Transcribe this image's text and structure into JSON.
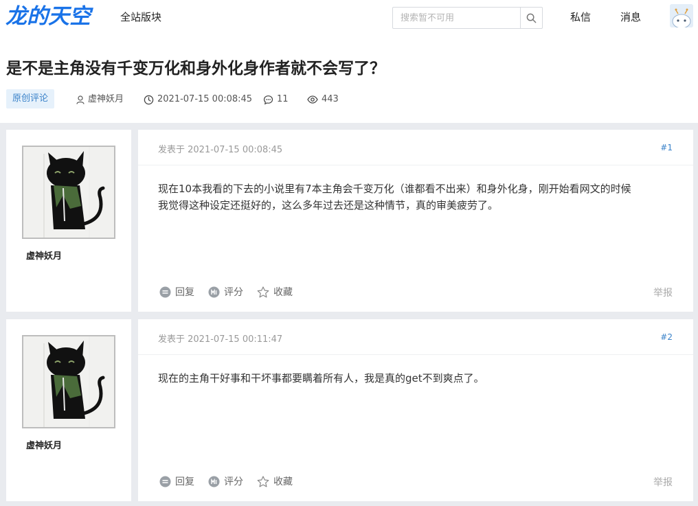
{
  "site": {
    "logo": "龙的天空",
    "nav_all_boards": "全站版块",
    "search_placeholder": "搜索暂不可用",
    "nav_messages": "私信",
    "nav_notifications": "消息",
    "brand_color": "#1a73e8"
  },
  "thread": {
    "title": "是不是主角没有千变万化和身外化身作者就不会写了？",
    "tag": "原创评论",
    "author": "虚神妖月",
    "datetime": "2021-07-15 00:08:45",
    "replies": "11",
    "views": "443"
  },
  "posts": [
    {
      "author": "虚神妖月",
      "date": "发表于 2021-07-15 00:08:45",
      "floor": "#1",
      "content_lines": [
        "现在10本我看的下去的小说里有7本主角会千变万化（谁都看不出来）和身外化身，刚开始看网文的时候",
        "我觉得这种设定还挺好的，这么多年过去还是这种情节，真的审美疲劳了。"
      ],
      "reply_label": "回复",
      "rate_label": "评分",
      "fav_label": "收藏",
      "report_label": "举报"
    },
    {
      "author": "虚神妖月",
      "date": "发表于 2021-07-15 00:11:47",
      "floor": "#2",
      "content_lines": [
        "现在的主角干好事和干坏事都要瞒着所有人，我是真的get不到爽点了。"
      ],
      "reply_label": "回复",
      "rate_label": "评分",
      "fav_label": "收藏",
      "report_label": "举报"
    }
  ]
}
